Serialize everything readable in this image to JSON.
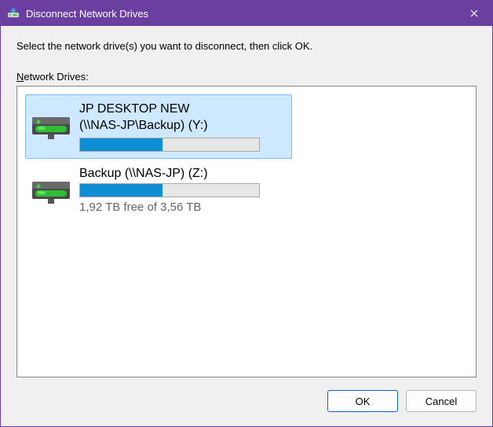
{
  "window": {
    "title": "Disconnect Network Drives"
  },
  "instruction": "Select the network drive(s) you want to disconnect, then click OK.",
  "list_label_prefix": "N",
  "list_label_rest": "etwork Drives:",
  "drives": [
    {
      "line1": "JP DESKTOP NEW",
      "line2": "(\\\\NAS-JP\\Backup) (Y:)",
      "usage_percent": 46,
      "free_text": "",
      "selected": true
    },
    {
      "line1": "Backup (\\\\NAS-JP) (Z:)",
      "line2": "",
      "usage_percent": 46,
      "free_text": "1,92 TB free of 3,56 TB",
      "selected": false
    }
  ],
  "buttons": {
    "ok": "OK",
    "cancel": "Cancel"
  }
}
